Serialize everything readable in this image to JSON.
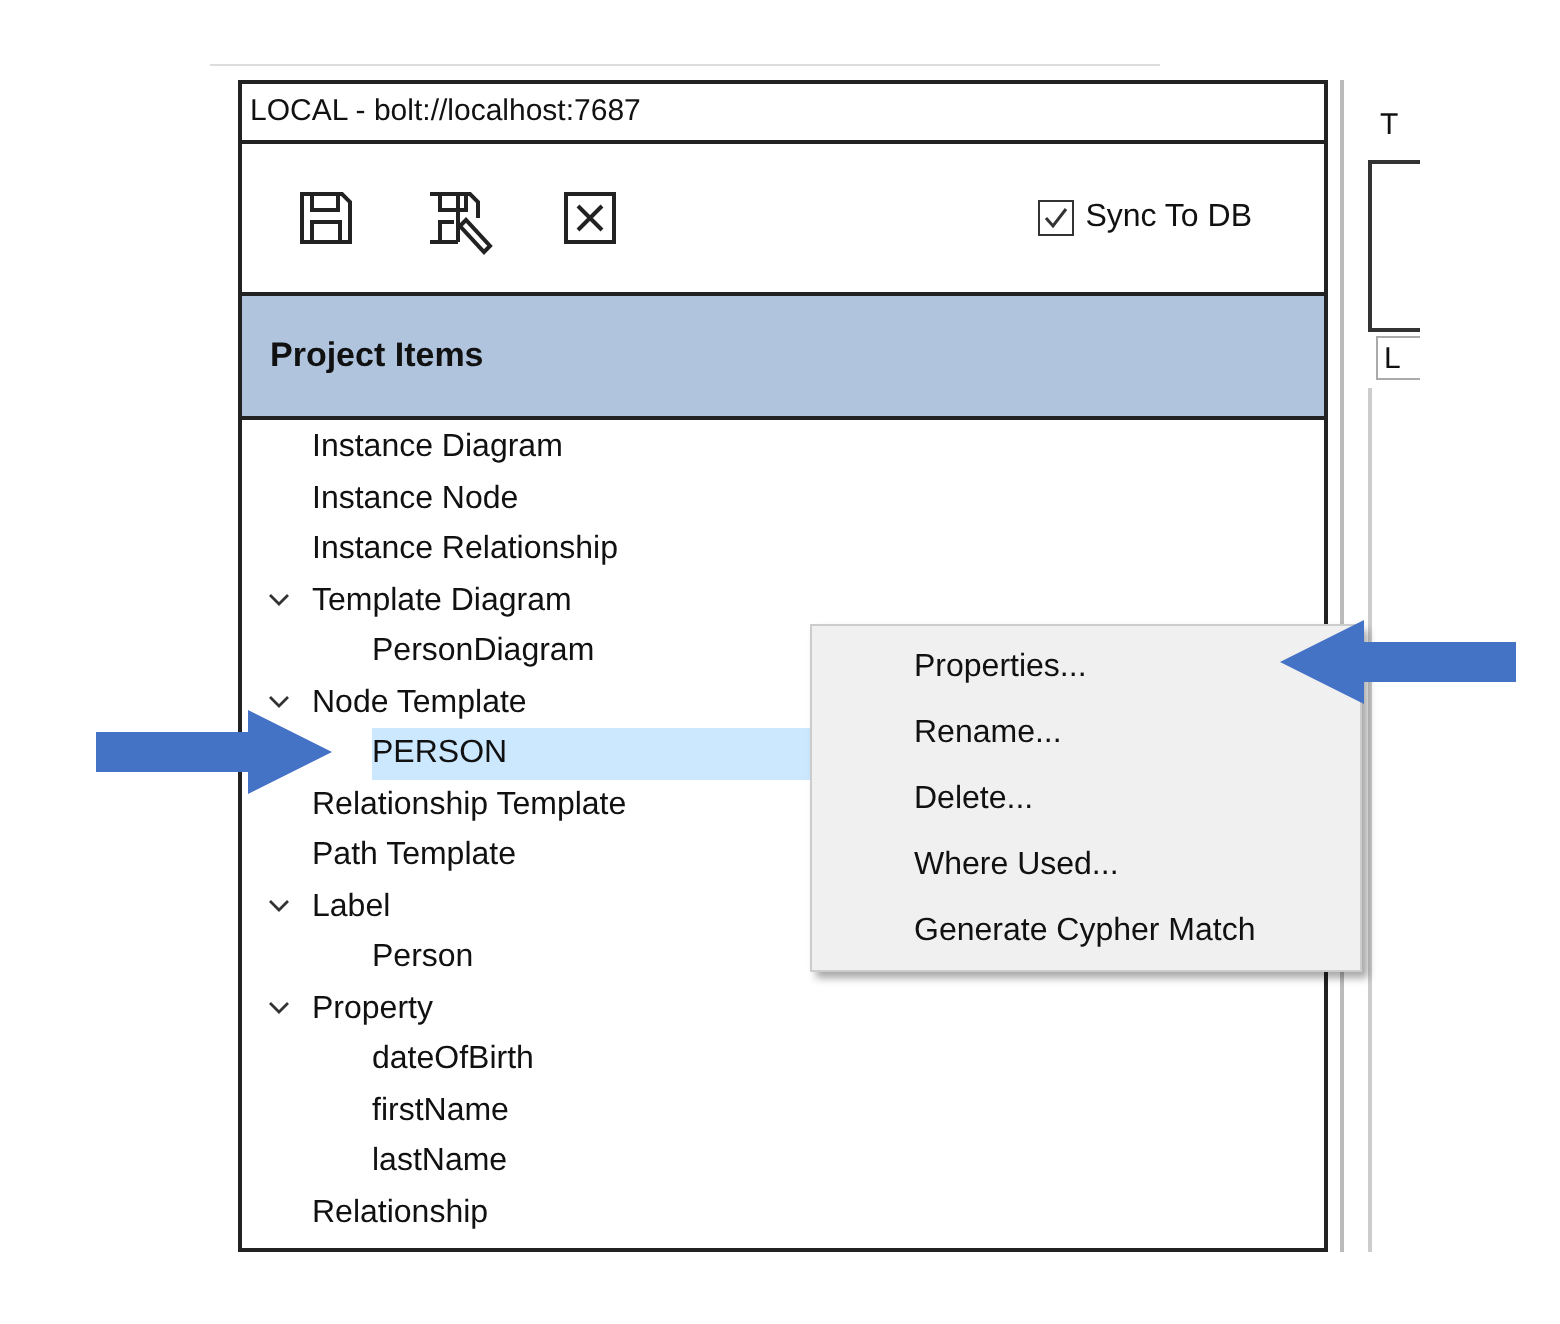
{
  "connection": {
    "title": "LOCAL - bolt://localhost:7687"
  },
  "toolbar": {
    "sync_checkbox": {
      "label": "Sync To DB",
      "checked": true
    }
  },
  "panel_header": "Project Items",
  "tree": [
    {
      "label": "Instance Diagram",
      "selected": false
    },
    {
      "label": "Instance Node",
      "selected": false
    },
    {
      "label": "Instance Relationship",
      "selected": false
    },
    {
      "label": "Template Diagram",
      "selected": false,
      "expanded": true,
      "children": [
        {
          "label": "PersonDiagram",
          "selected": false
        }
      ]
    },
    {
      "label": "Node Template",
      "selected": false,
      "expanded": true,
      "children": [
        {
          "label": "PERSON",
          "selected": true
        }
      ]
    },
    {
      "label": "Relationship Template",
      "selected": false
    },
    {
      "label": "Path Template",
      "selected": false
    },
    {
      "label": "Label",
      "selected": false,
      "expanded": true,
      "children": [
        {
          "label": "Person",
          "selected": false
        }
      ]
    },
    {
      "label": "Property",
      "selected": false,
      "expanded": true,
      "children": [
        {
          "label": "dateOfBirth",
          "selected": false
        },
        {
          "label": "firstName",
          "selected": false
        },
        {
          "label": "lastName",
          "selected": false
        }
      ]
    },
    {
      "label": "Relationship",
      "selected": false
    }
  ],
  "context_menu": [
    "Properties...",
    "Rename...",
    "Delete...",
    "Where Used...",
    "Generate Cypher Match"
  ],
  "right_panel": {
    "tab_fragment": "T",
    "field_fragment": "L"
  }
}
